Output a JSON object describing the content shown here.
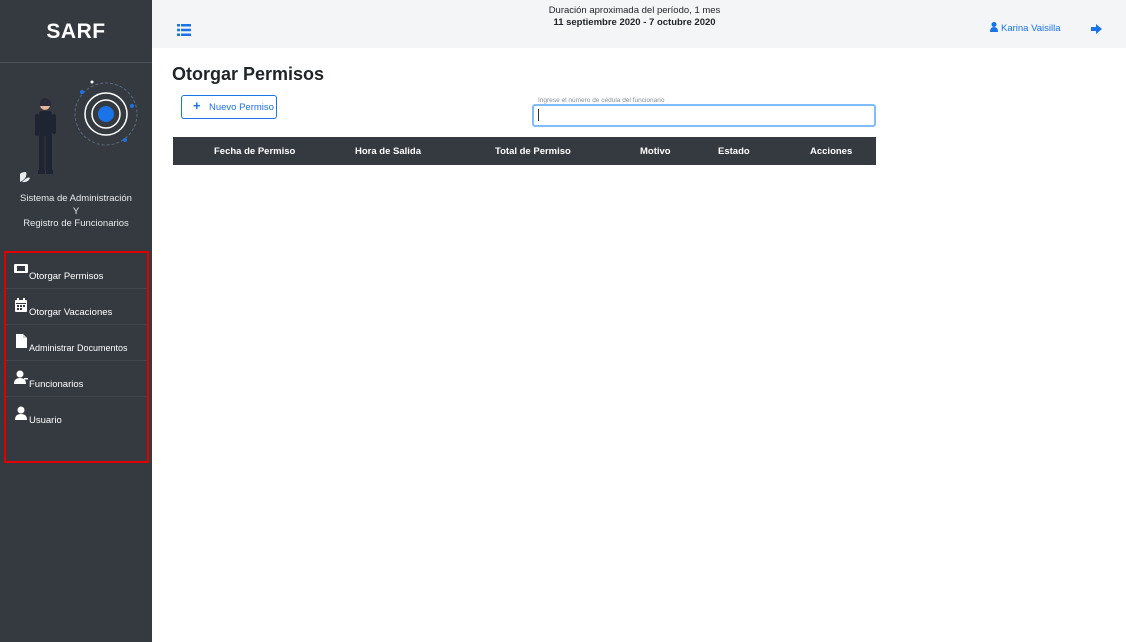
{
  "brand": {
    "name": "SARF"
  },
  "system": {
    "line1": "Sistema de Administración",
    "line2": "Y",
    "line3": "Registro de Funcionarios"
  },
  "menu": [
    {
      "label": "Otorgar Permisos",
      "icon": "ticket-icon"
    },
    {
      "label": "Otorgar Vacaciones",
      "icon": "calendar-icon"
    },
    {
      "label": "Administrar Documentos",
      "icon": "file-icon"
    },
    {
      "label": "Funcionarios",
      "icon": "users-icon"
    },
    {
      "label": "Usuario",
      "icon": "user-icon"
    }
  ],
  "topbar": {
    "period_text": "Duración aproximada del período, 1 mes",
    "period_range": "11 septiembre 2020 - 7 octubre 2020",
    "user_name": "Karina Vaisilla"
  },
  "main": {
    "title": "Otorgar Permisos",
    "new_button": "Nuevo Permiso",
    "search_label": "Ingrese el número de cédula del funcionario",
    "search_value": "",
    "table_headers": [
      "Fecha de Permiso",
      "Hora de Salida",
      "Total de Permiso",
      "Motivo",
      "Estado",
      "Acciones"
    ]
  },
  "colors": {
    "sidebar": "#343a40",
    "accent": "#1a73e8",
    "highlight_border": "#e00000",
    "topbar": "#f4f5f7"
  }
}
